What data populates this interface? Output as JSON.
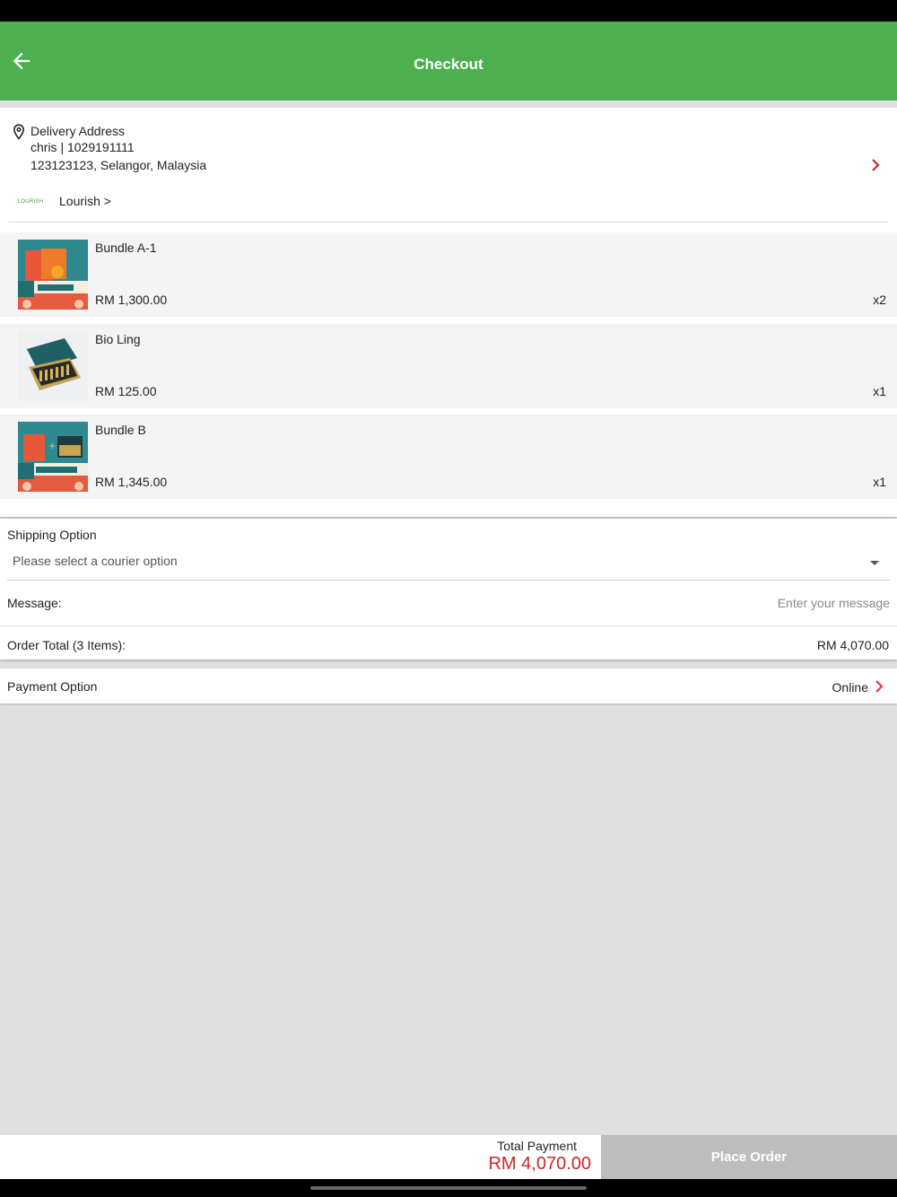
{
  "header": {
    "title": "Checkout"
  },
  "address": {
    "label": "Delivery Address",
    "name_phone": "chris | 1029191111",
    "line": "123123123, Selangor, Malaysia"
  },
  "store": {
    "logo_text": "LOURISH",
    "name": "Lourish >"
  },
  "items": [
    {
      "name": "Bundle A-1",
      "price": "RM 1,300.00",
      "qty": "x2"
    },
    {
      "name": "Bio Ling",
      "price": "RM 125.00",
      "qty": "x1"
    },
    {
      "name": "Bundle B",
      "price": "RM 1,345.00",
      "qty": "x1"
    }
  ],
  "shipping": {
    "label": "Shipping Option",
    "placeholder": "Please select a courier option"
  },
  "message": {
    "label": "Message:",
    "placeholder": "Enter your message",
    "value": ""
  },
  "order_total": {
    "label": "Order Total (3 Items):",
    "value": "RM 4,070.00"
  },
  "payment": {
    "label": "Payment Option",
    "value": "Online"
  },
  "footer": {
    "total_label": "Total Payment",
    "total_value": "RM 4,070.00",
    "button_label": "Place Order"
  },
  "colors": {
    "primary": "#4caf50",
    "accent_red": "#c62828",
    "disabled_button": "#bdbdbd"
  }
}
